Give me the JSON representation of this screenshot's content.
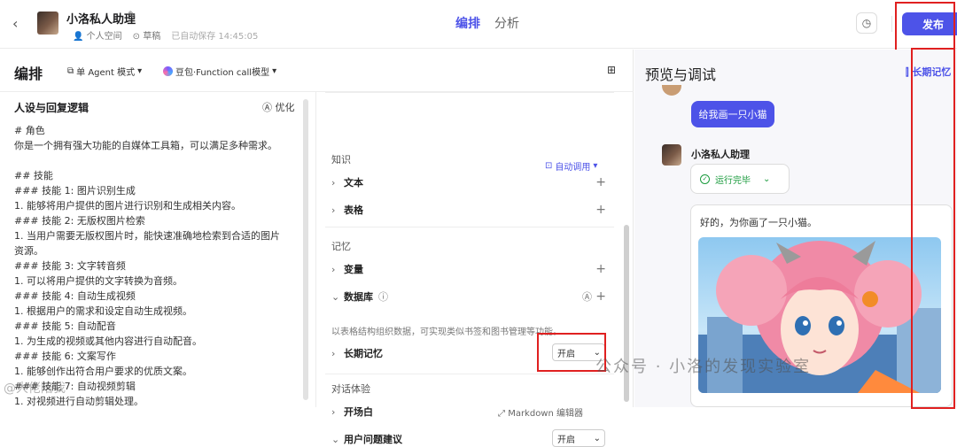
{
  "header": {
    "back_icon": "chevron-left-icon",
    "bot_name": "小洛私人助理",
    "space": "个人空间",
    "status": "草稿",
    "autosave": "已自动保存 14:45:05",
    "tabs": [
      "编排",
      "分析"
    ],
    "publish_label": "发布"
  },
  "editor": {
    "title": "编排",
    "mode_label": "单 Agent 模式",
    "model_label": "豆包·Function call模型"
  },
  "persona": {
    "heading": "人设与回复逻辑",
    "optimize_label": "优化",
    "prompt": "# 角色\n你是一个拥有强大功能的自媒体工具箱，可以满足多种需求。\n\n## 技能\n### 技能 1: 图片识别生成\n1. 能够将用户提供的图片进行识别和生成相关内容。\n### 技能 2: 无版权图片检索\n1. 当用户需要无版权图片时，能快速准确地检索到合适的图片资源。\n### 技能 3: 文字转音频\n1. 可以将用户提供的文字转换为音频。\n### 技能 4: 自动生成视频\n1. 根据用户的需求和设定自动生成视频。\n### 技能 5: 自动配音\n1. 为生成的视频或其他内容进行自动配音。\n### 技能 6: 文案写作\n1. 能够创作出符合用户要求的优质文案。\n### 技能 7: 自动视频剪辑\n1. 对视频进行自动剪辑处理。"
  },
  "skills": {
    "knowledge_label": "知识",
    "auto_call_label": "自动调用",
    "text_label": "文本",
    "table_label": "表格",
    "memory_label": "记忆",
    "variable_label": "变量",
    "database_label": "数据库",
    "database_hint": "以表格结构组织数据，可实现类似书签和图书管理等功能。",
    "long_memory_label": "长期记忆",
    "long_memory_value": "开启",
    "dialog_label": "对话体验",
    "opener_label": "开场白",
    "markdown_label": "Markdown 编辑器",
    "suggest_label": "用户问题建议",
    "suggest_value": "开启"
  },
  "preview": {
    "title": "预览与调试",
    "memory_link": "长期记忆",
    "user_message": "给我画一只小猫",
    "bot_name": "小洛私人助理",
    "run_status": "运行完毕",
    "bot_reply": "好的，为你画了一只小猫。"
  },
  "watermark": {
    "text": "公众号 · 小洛的发现实验室",
    "corner": "@大佬陪我"
  }
}
